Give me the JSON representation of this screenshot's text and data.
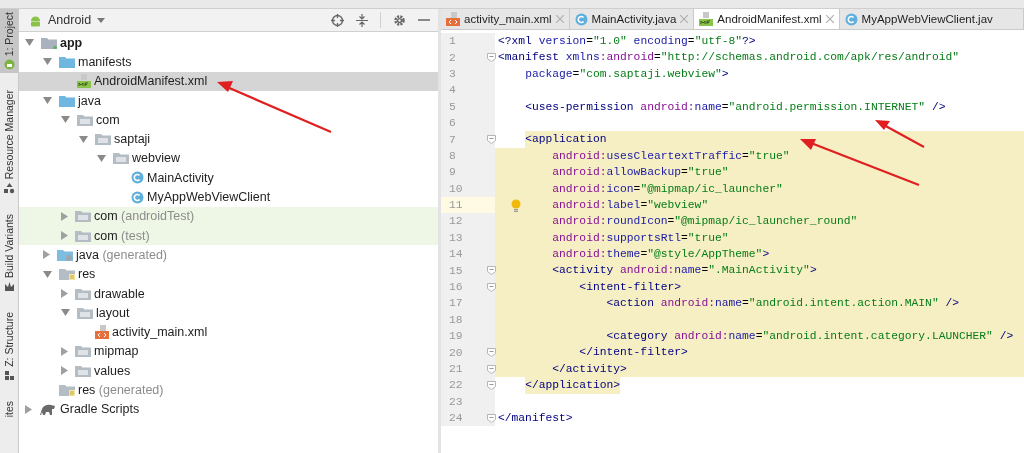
{
  "tool_strip": [
    {
      "label": "1: Project",
      "selected": true,
      "kind": "project"
    },
    {
      "label": "Resource Manager",
      "selected": false,
      "kind": "resources"
    },
    {
      "label": "Build Variants",
      "selected": false,
      "kind": "variants"
    },
    {
      "label": "Z: Structure",
      "selected": false,
      "kind": "structure"
    },
    {
      "label": "ites",
      "selected": false,
      "kind": "none"
    }
  ],
  "project_panel": {
    "view": "Android",
    "tree": [
      {
        "label": "app",
        "kind": "module",
        "expanded": true,
        "selected": false,
        "test": false,
        "children": [
          {
            "label": "manifests",
            "kind": "source-folder",
            "expanded": true,
            "selected": false,
            "test": false,
            "children": [
              {
                "label": "AndroidManifest.xml",
                "kind": "manifest",
                "selected": true,
                "test": false
              }
            ]
          },
          {
            "label": "java",
            "kind": "source-folder",
            "expanded": true,
            "selected": false,
            "test": false,
            "children": [
              {
                "label": "com",
                "kind": "package",
                "expanded": true,
                "selected": false,
                "test": false,
                "children": [
                  {
                    "label": "saptaji",
                    "kind": "package",
                    "expanded": true,
                    "selected": false,
                    "test": false,
                    "children": [
                      {
                        "label": "webview",
                        "kind": "package",
                        "expanded": true,
                        "selected": false,
                        "test": false,
                        "children": [
                          {
                            "label": "MainActivity",
                            "kind": "class",
                            "selected": false,
                            "test": false
                          },
                          {
                            "label": "MyAppWebViewClient",
                            "kind": "class",
                            "selected": false,
                            "test": false
                          }
                        ]
                      }
                    ]
                  }
                ]
              },
              {
                "label": "com",
                "note": "(androidTest)",
                "kind": "package",
                "expanded": false,
                "selected": false,
                "test": true
              },
              {
                "label": "com",
                "note": "(test)",
                "kind": "package",
                "expanded": false,
                "selected": false,
                "test": true
              }
            ]
          },
          {
            "label": "java",
            "note": "(generated)",
            "kind": "generated-folder",
            "expanded": false,
            "selected": false,
            "test": false
          },
          {
            "label": "res",
            "kind": "res-folder",
            "expanded": true,
            "selected": false,
            "test": false,
            "children": [
              {
                "label": "drawable",
                "kind": "package",
                "expanded": false,
                "selected": false,
                "test": false
              },
              {
                "label": "layout",
                "kind": "package",
                "expanded": true,
                "selected": false,
                "test": false,
                "children": [
                  {
                    "label": "activity_main.xml",
                    "kind": "layout-file",
                    "selected": false,
                    "test": false
                  }
                ]
              },
              {
                "label": "mipmap",
                "kind": "package",
                "expanded": false,
                "selected": false,
                "test": false
              },
              {
                "label": "values",
                "kind": "package",
                "expanded": false,
                "selected": false,
                "test": false
              }
            ]
          },
          {
            "label": "res",
            "note": "(generated)",
            "kind": "res-folder",
            "selected": false,
            "test": false
          }
        ]
      },
      {
        "label": "Gradle Scripts",
        "kind": "gradle",
        "expanded": false,
        "selected": false,
        "test": false
      }
    ]
  },
  "editor": {
    "tabs": [
      {
        "label": "activity_main.xml",
        "kind": "layout-file",
        "selected": false
      },
      {
        "label": "MainActivity.java",
        "kind": "class",
        "selected": false
      },
      {
        "label": "AndroidManifest.xml",
        "kind": "manifest",
        "selected": true
      },
      {
        "label": "MyAppWebViewClient.jav",
        "kind": "class",
        "selected": false
      }
    ],
    "lines": [
      {
        "number": "1",
        "fold": false,
        "current": false,
        "kind": "plain",
        "tokens": [
          {
            "kind": "tag",
            "text": "<?xml"
          },
          {
            "kind": "attr",
            "text": " version"
          },
          {
            "kind": "plain",
            "text": "="
          },
          {
            "kind": "value",
            "text": "\"1.0\""
          },
          {
            "kind": "attr",
            "text": " encoding"
          },
          {
            "kind": "plain",
            "text": "="
          },
          {
            "kind": "value",
            "text": "\"utf-8\""
          },
          {
            "kind": "tag",
            "text": "?>"
          }
        ]
      },
      {
        "number": "2",
        "fold": true,
        "current": false,
        "kind": "plain",
        "tokens": [
          {
            "kind": "tag",
            "text": "<manifest"
          },
          {
            "kind": "attr",
            "text": " xmlns"
          },
          {
            "kind": "ns",
            "text": ":android"
          },
          {
            "kind": "plain",
            "text": "="
          },
          {
            "kind": "value",
            "text": "\"http://schemas.android.com/apk/res/android\""
          }
        ]
      },
      {
        "number": "3",
        "fold": false,
        "current": false,
        "kind": "plain",
        "tokens": [
          {
            "kind": "attr",
            "text": "    package"
          },
          {
            "kind": "plain",
            "text": "="
          },
          {
            "kind": "value",
            "text": "\"com.saptaji.webview\""
          },
          {
            "kind": "tag",
            "text": ">"
          }
        ]
      },
      {
        "number": "4",
        "fold": false,
        "current": false,
        "kind": "plain"
      },
      {
        "number": "5",
        "fold": false,
        "current": false,
        "kind": "plain",
        "tokens": [
          {
            "kind": "tag",
            "text": "    <uses-permission"
          },
          {
            "kind": "ns",
            "text": " android:"
          },
          {
            "kind": "attr",
            "text": "name"
          },
          {
            "kind": "plain",
            "text": "="
          },
          {
            "kind": "value",
            "text": "\"android.permission.INTERNET\""
          },
          {
            "kind": "tag",
            "text": " />"
          }
        ]
      },
      {
        "number": "6",
        "fold": false,
        "current": false,
        "kind": "plain"
      },
      {
        "number": "7",
        "fold": true,
        "current": false,
        "kind": "highlight-start",
        "tokens": [
          {
            "kind": "tag",
            "text": "    <application"
          }
        ]
      },
      {
        "number": "8",
        "fold": false,
        "current": false,
        "kind": "highlighted",
        "tokens": [
          {
            "kind": "ns",
            "text": "        android:"
          },
          {
            "kind": "attr",
            "text": "usesCleartextTraffic"
          },
          {
            "kind": "plain",
            "text": "="
          },
          {
            "kind": "value",
            "text": "\"true\""
          }
        ]
      },
      {
        "number": "9",
        "fold": false,
        "current": false,
        "kind": "highlighted",
        "tokens": [
          {
            "kind": "ns",
            "text": "        android:"
          },
          {
            "kind": "attr",
            "text": "allowBackup"
          },
          {
            "kind": "plain",
            "text": "="
          },
          {
            "kind": "value",
            "text": "\"true\""
          }
        ]
      },
      {
        "number": "10",
        "fold": false,
        "current": false,
        "kind": "highlighted",
        "tokens": [
          {
            "kind": "ns",
            "text": "        android:"
          },
          {
            "kind": "attr",
            "text": "icon"
          },
          {
            "kind": "plain",
            "text": "="
          },
          {
            "kind": "value",
            "text": "\"@mipmap/ic_launcher\""
          }
        ]
      },
      {
        "number": "11",
        "fold": false,
        "current": true,
        "kind": "highlighted",
        "tokens": [
          {
            "kind": "ns",
            "text": "        android:"
          },
          {
            "kind": "attr",
            "text": "label"
          },
          {
            "kind": "plain",
            "text": "="
          },
          {
            "kind": "value",
            "text": "\"webview\""
          }
        ]
      },
      {
        "number": "12",
        "fold": false,
        "current": false,
        "kind": "highlighted",
        "tokens": [
          {
            "kind": "ns",
            "text": "        android:"
          },
          {
            "kind": "attr",
            "text": "roundIcon"
          },
          {
            "kind": "plain",
            "text": "="
          },
          {
            "kind": "value",
            "text": "\"@mipmap/ic_launcher_round\""
          }
        ]
      },
      {
        "number": "13",
        "fold": false,
        "current": false,
        "kind": "highlighted",
        "tokens": [
          {
            "kind": "ns",
            "text": "        android:"
          },
          {
            "kind": "attr",
            "text": "supportsRtl"
          },
          {
            "kind": "plain",
            "text": "="
          },
          {
            "kind": "value",
            "text": "\"true\""
          }
        ]
      },
      {
        "number": "14",
        "fold": false,
        "current": false,
        "kind": "highlighted",
        "tokens": [
          {
            "kind": "ns",
            "text": "        android:"
          },
          {
            "kind": "attr",
            "text": "theme"
          },
          {
            "kind": "plain",
            "text": "="
          },
          {
            "kind": "value",
            "text": "\"@style/AppTheme\""
          },
          {
            "kind": "tag",
            "text": ">"
          }
        ]
      },
      {
        "number": "15",
        "fold": true,
        "current": false,
        "kind": "highlighted",
        "tokens": [
          {
            "kind": "tag",
            "text": "        <activity"
          },
          {
            "kind": "ns",
            "text": " android:"
          },
          {
            "kind": "attr",
            "text": "name"
          },
          {
            "kind": "plain",
            "text": "="
          },
          {
            "kind": "value",
            "text": "\".MainActivity\""
          },
          {
            "kind": "tag",
            "text": ">"
          }
        ]
      },
      {
        "number": "16",
        "fold": true,
        "current": false,
        "kind": "highlighted",
        "tokens": [
          {
            "kind": "tag",
            "text": "            <intent-filter>"
          }
        ]
      },
      {
        "number": "17",
        "fold": false,
        "current": false,
        "kind": "highlighted",
        "tokens": [
          {
            "kind": "tag",
            "text": "                <action"
          },
          {
            "kind": "ns",
            "text": " android:"
          },
          {
            "kind": "attr",
            "text": "name"
          },
          {
            "kind": "plain",
            "text": "="
          },
          {
            "kind": "value",
            "text": "\"android.intent.action.MAIN\""
          },
          {
            "kind": "tag",
            "text": " />"
          }
        ]
      },
      {
        "number": "18",
        "fold": false,
        "current": false,
        "kind": "highlighted"
      },
      {
        "number": "19",
        "fold": false,
        "current": false,
        "kind": "highlighted",
        "tokens": [
          {
            "kind": "tag",
            "text": "                <category"
          },
          {
            "kind": "ns",
            "text": " android:"
          },
          {
            "kind": "attr",
            "text": "name"
          },
          {
            "kind": "plain",
            "text": "="
          },
          {
            "kind": "value",
            "text": "\"android.intent.category.LAUNCHER\""
          },
          {
            "kind": "tag",
            "text": " />"
          }
        ]
      },
      {
        "number": "20",
        "fold": true,
        "current": false,
        "kind": "highlighted",
        "tokens": [
          {
            "kind": "tag",
            "text": "            </intent-filter>"
          }
        ]
      },
      {
        "number": "21",
        "fold": true,
        "current": false,
        "kind": "highlighted",
        "tokens": [
          {
            "kind": "tag",
            "text": "        </activity>"
          }
        ]
      },
      {
        "number": "22",
        "fold": true,
        "current": false,
        "kind": "highlight-end",
        "tokens": [
          {
            "kind": "tag",
            "text": "    </application>"
          }
        ]
      },
      {
        "number": "23",
        "fold": false,
        "current": false,
        "kind": "plain"
      },
      {
        "number": "24",
        "fold": true,
        "current": false,
        "kind": "plain",
        "tokens": [
          {
            "kind": "tag",
            "text": "</manifest>"
          }
        ]
      }
    ]
  }
}
